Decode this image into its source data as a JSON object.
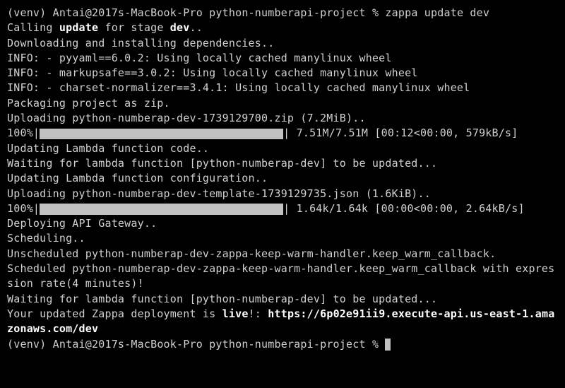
{
  "prompt1": {
    "venv": "(venv)",
    "user_host": "Antai@2017s-MacBook-Pro",
    "cwd": "python-numberapi-project",
    "sep": "%",
    "command": "zappa update dev"
  },
  "calling": {
    "prefix": "Calling ",
    "update": "update",
    "mid": " for stage ",
    "stage": "dev",
    "suffix": ".."
  },
  "download_line": "Downloading and installing dependencies..",
  "info1": "INFO: - pyyaml==6.0.2: Using locally cached manylinux wheel",
  "info2": "INFO: - markupsafe==3.0.2: Using locally cached manylinux wheel",
  "info3": "INFO: - charset-normalizer==3.4.1: Using locally cached manylinux wheel",
  "packaging": "Packaging project as zip.",
  "upload1": "Uploading python-numberap-dev-1739129700.zip (7.2MiB)..",
  "progress1": {
    "pct": "100%|",
    "stats": "| 7.51M/7.51M [00:12<00:00, 579kB/s]"
  },
  "updating_code": "Updating Lambda function code..",
  "wait1": "Waiting for lambda function [python-numberap-dev] to be updated...",
  "updating_conf": "Updating Lambda function configuration..",
  "upload2": "Uploading python-numberap-dev-template-1739129735.json (1.6KiB)..",
  "progress2": {
    "pct": "100%|",
    "stats": "| 1.64k/1.64k [00:00<00:00, 2.64kB/s]"
  },
  "deploying": "Deploying API Gateway..",
  "scheduling": "Scheduling..",
  "unscheduled": "Unscheduled python-numberap-dev-zappa-keep-warm-handler.keep_warm_callback.",
  "scheduled": "Scheduled python-numberap-dev-zappa-keep-warm-handler.keep_warm_callback with expression rate(4 minutes)!",
  "wait2": "Waiting for lambda function [python-numberap-dev] to be updated...",
  "final": {
    "prefix": "Your updated Zappa deployment is ",
    "live": "live",
    "exclaim": "!: ",
    "url": "https://6p02e91ii9.execute-api.us-east-1.amazonaws.com/dev"
  },
  "prompt2": {
    "venv": "(venv)",
    "user_host": "Antai@2017s-MacBook-Pro",
    "cwd": "python-numberapi-project",
    "sep": "%"
  }
}
